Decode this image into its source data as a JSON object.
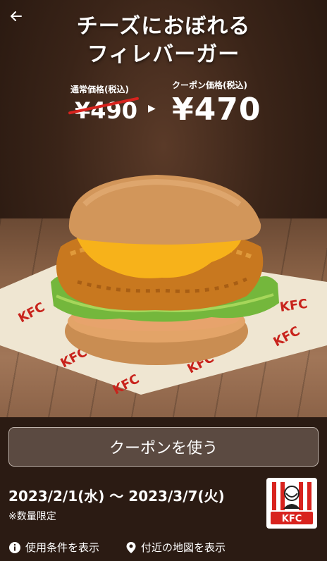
{
  "header": {
    "back_icon": "arrow-left-icon"
  },
  "promo": {
    "title_line1": "チーズにおぼれる",
    "title_line2": "フィレバーガー",
    "regular_price_label": "通常価格(税込)",
    "regular_price": "¥490",
    "coupon_price_label": "クーポン価格(税込)",
    "coupon_price": "¥470",
    "arrow_icon": "triangle-right-icon"
  },
  "image": {
    "brand_mark": "KFC"
  },
  "coupon": {
    "use_button_label": "クーポンを使う",
    "date_range": "2023/2/1(水) 〜 2023/3/7(火)",
    "limit_note": "※数量限定"
  },
  "logo": {
    "text": "KFC"
  },
  "footer": {
    "terms_label": "使用条件を表示",
    "terms_icon": "info-icon",
    "map_label": "付近の地図を表示",
    "map_icon": "location-pin-icon"
  },
  "colors": {
    "brand_red": "#d8231e",
    "background": "#2b1b13",
    "button_bg": "#5b4a41"
  }
}
